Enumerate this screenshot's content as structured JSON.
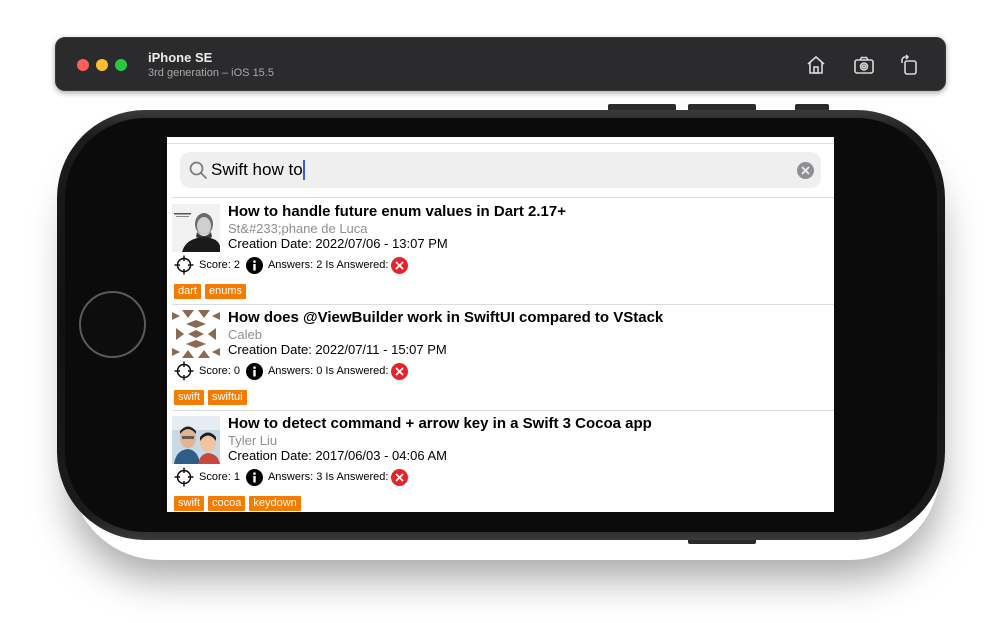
{
  "simulator": {
    "device_name": "iPhone SE",
    "device_subtitle": "3rd generation – iOS 15.5"
  },
  "search": {
    "value": "Swift how to"
  },
  "colors": {
    "tag_bg": "#f57c00",
    "answered_no": "#e8232a",
    "caret": "#3b5bdb"
  },
  "questions": [
    {
      "title": "How to handle future enum values in Dart 2.17+",
      "author": "St&#233;phane de Luca",
      "date": "Creation Date: 2022/07/06 - 13:07 PM",
      "score": "Score: 2",
      "answers": "Answers: 2 Is Answered:",
      "answered_icon": "x-circle-icon",
      "tags": [
        "dart",
        "enums"
      ]
    },
    {
      "title": "How does @ViewBuilder work in SwiftUI compared to VStack",
      "author": "Caleb",
      "date": "Creation Date: 2022/07/11 - 15:07 PM",
      "score": "Score: 0",
      "answers": "Answers: 0 Is Answered:",
      "answered_icon": "x-circle-icon",
      "tags": [
        "swift",
        "swiftui"
      ]
    },
    {
      "title": "How to detect command + arrow key in a Swift 3 Cocoa app",
      "author": "Tyler Liu",
      "date": "Creation Date: 2017/06/03 - 04:06 AM",
      "score": "Score: 1",
      "answers": "Answers: 3 Is Answered:",
      "answered_icon": "x-circle-icon",
      "tags": [
        "swift",
        "cocoa",
        "keydown"
      ]
    }
  ]
}
